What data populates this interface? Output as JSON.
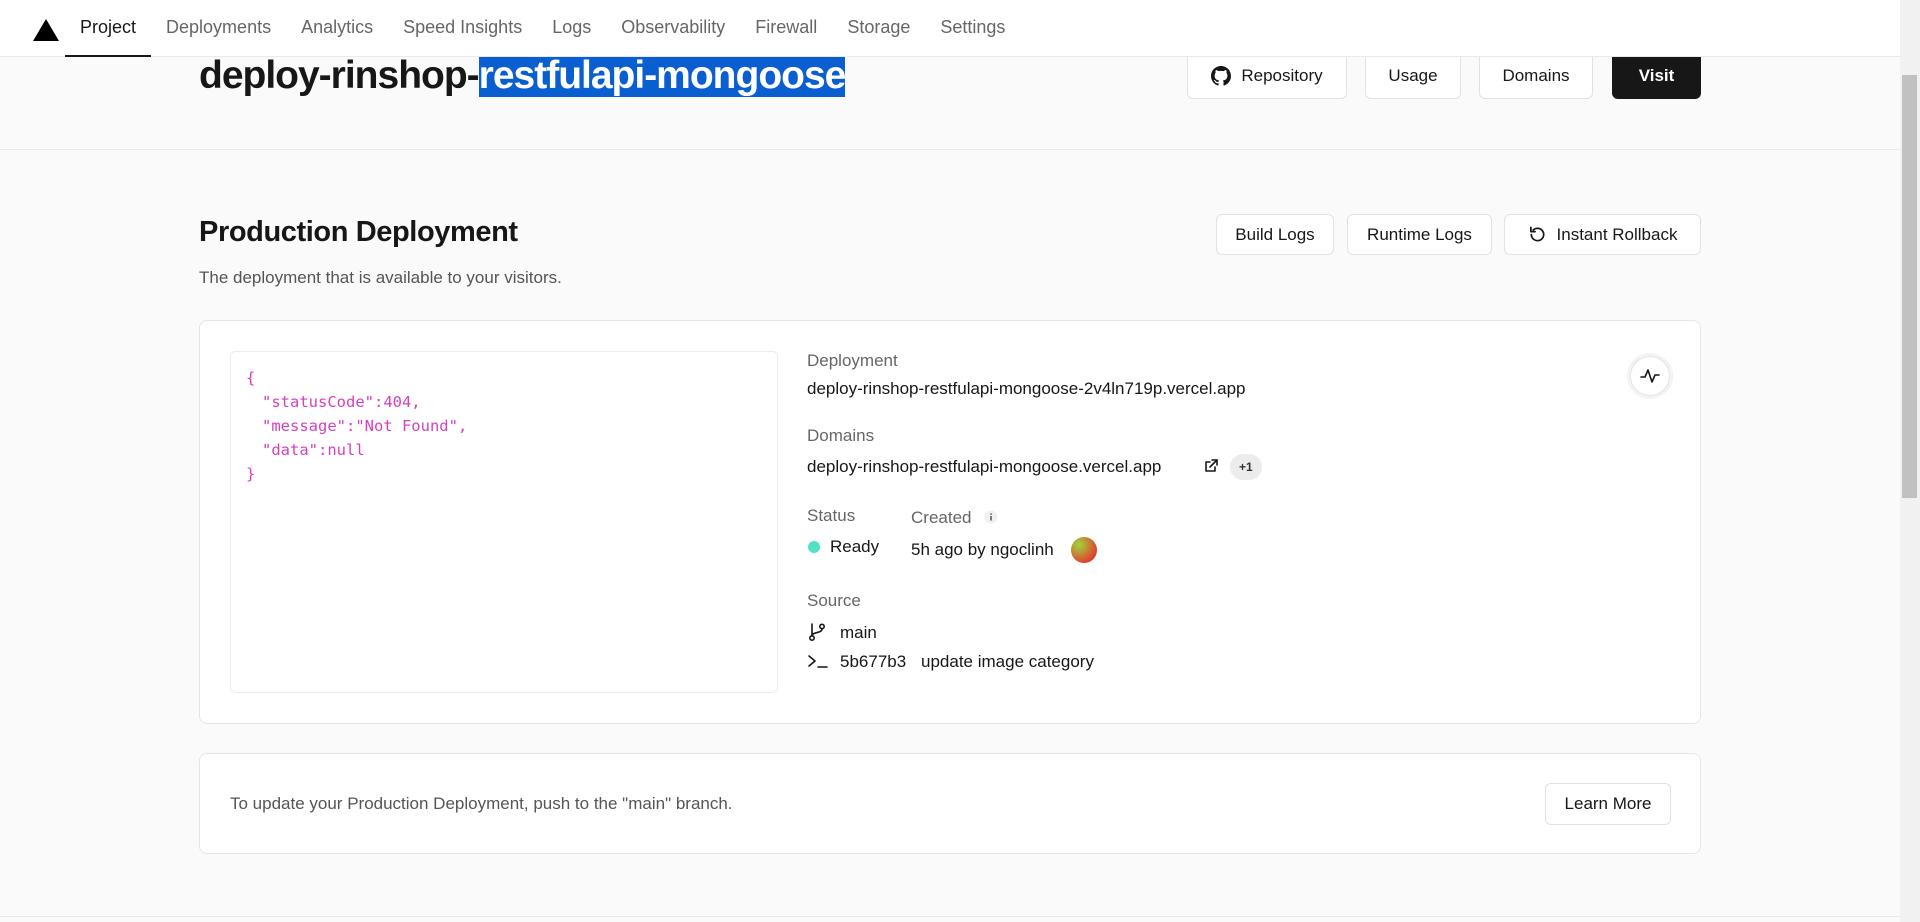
{
  "nav": {
    "tabs": [
      {
        "label": "Project",
        "active": true
      },
      {
        "label": "Deployments"
      },
      {
        "label": "Analytics"
      },
      {
        "label": "Speed Insights"
      },
      {
        "label": "Logs"
      },
      {
        "label": "Observability"
      },
      {
        "label": "Firewall"
      },
      {
        "label": "Storage"
      },
      {
        "label": "Settings"
      }
    ]
  },
  "header": {
    "title_prefix": "deploy-rinshop-",
    "title_selected": "restfulapi-mongoose",
    "buttons": {
      "repository": "Repository",
      "usage": "Usage",
      "domains": "Domains",
      "visit": "Visit"
    }
  },
  "production": {
    "title": "Production Deployment",
    "subtitle": "The deployment that is available to your visitors.",
    "buttons": {
      "build_logs": "Build Logs",
      "runtime_logs": "Runtime Logs",
      "instant_rollback": "Instant Rollback"
    },
    "preview": {
      "open": "{",
      "line1": "\"statusCode\":404,",
      "line2": "\"message\":\"Not Found\",",
      "line3": "\"data\":null",
      "close": "}"
    },
    "deployment_label": "Deployment",
    "deployment_url": "deploy-rinshop-restfulapi-mongoose-2v4ln719p.vercel.app",
    "domains_label": "Domains",
    "domain_url": "deploy-rinshop-restfulapi-mongoose.vercel.app",
    "domain_extra": "+1",
    "status_label": "Status",
    "status_value": "Ready",
    "created_label": "Created",
    "created_value": "5h ago by ngoclinh",
    "source_label": "Source",
    "branch": "main",
    "commit_hash": "5b677b3",
    "commit_message": "update image category"
  },
  "info": {
    "text": "To update your Production Deployment, push to the \"main\" branch.",
    "learn_more": "Learn More"
  },
  "colors": {
    "accent_dark": "#171717",
    "selection": "#0a5fd0",
    "status_ready": "#50e3c2",
    "json_text": "#d73ec3"
  }
}
